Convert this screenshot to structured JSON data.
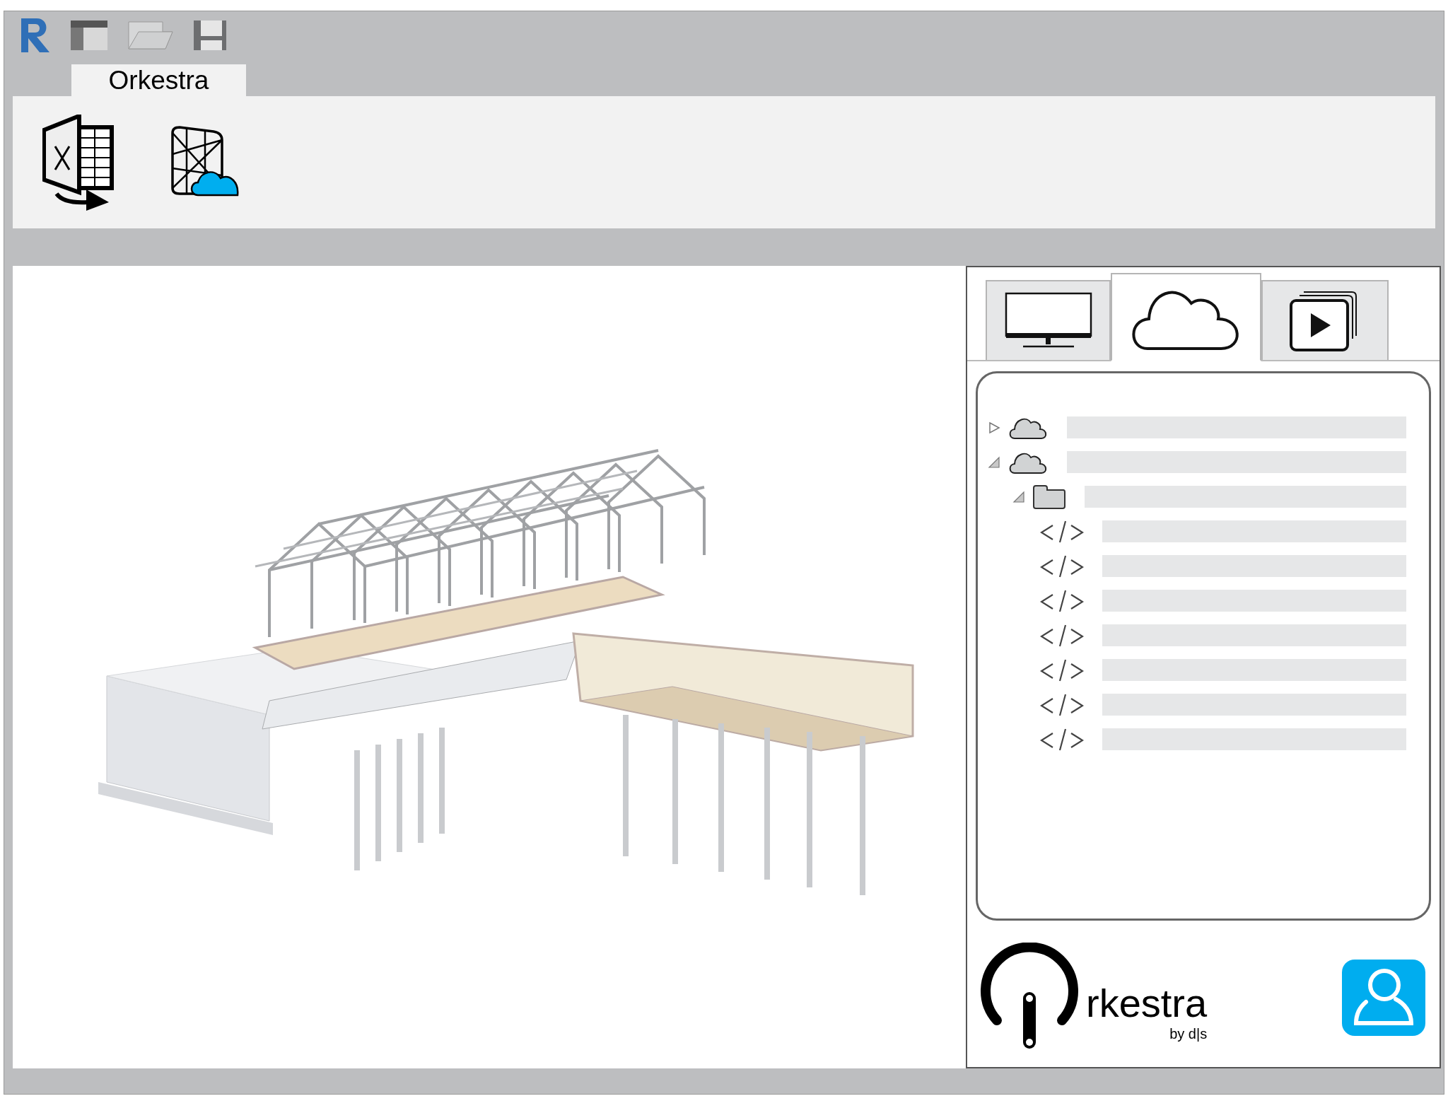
{
  "ribbon": {
    "tab": "Orkestra"
  },
  "panel_tabs": [
    {
      "kind": "monitor",
      "selected": false
    },
    {
      "kind": "cloud",
      "selected": true
    },
    {
      "kind": "media",
      "selected": false
    }
  ],
  "tree": [
    {
      "kind": "cloud",
      "expanded": false
    },
    {
      "kind": "cloud",
      "expanded": true,
      "children": [
        {
          "kind": "folder",
          "expanded": true,
          "children": [
            {
              "kind": "code"
            },
            {
              "kind": "code"
            },
            {
              "kind": "code"
            },
            {
              "kind": "code"
            },
            {
              "kind": "code"
            },
            {
              "kind": "code"
            },
            {
              "kind": "code"
            }
          ]
        }
      ]
    }
  ],
  "logo": {
    "wordmark": "rkestra",
    "byline": "by d|s"
  }
}
